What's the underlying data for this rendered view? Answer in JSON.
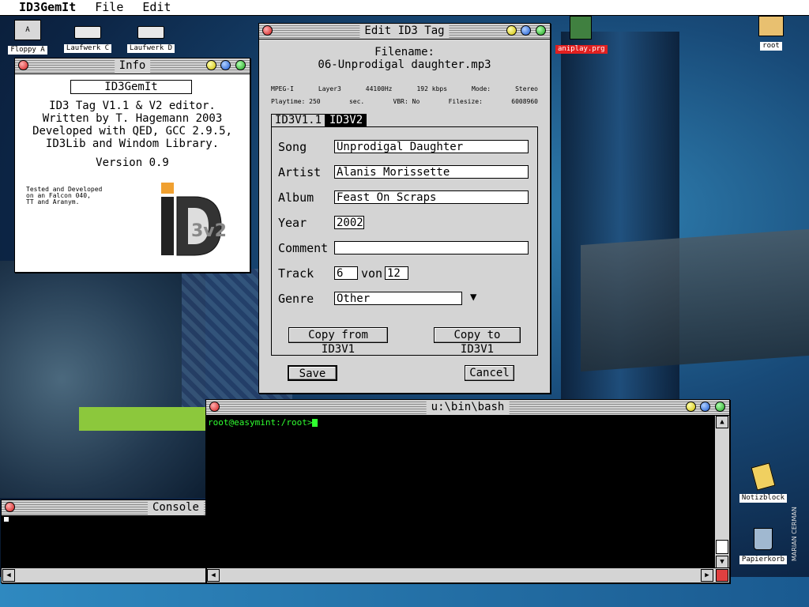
{
  "menubar": {
    "app": "ID3GemIt",
    "items": [
      "File",
      "Edit"
    ]
  },
  "desktop_icons": {
    "floppy": "Floppy A",
    "drive_c": "Laufwerk C",
    "drive_d": "Laufwerk D",
    "aniplay": "aniplay.prg",
    "root": "root",
    "notepad": "Notizblock",
    "trash": "Papierkorb"
  },
  "info_window": {
    "title": "Info",
    "app_name": "ID3GemIt",
    "lines": [
      "ID3 Tag V1.1 & V2 editor.",
      "Written by T. Hagemann 2003",
      "Developed with QED, GCC 2.9.5,",
      "ID3Lib and Windom Library."
    ],
    "version": "Version 0.9",
    "tested": [
      "Tested and Developed",
      "on an Falcon 040,",
      "TT and Aranym."
    ],
    "logo_text": "3v2"
  },
  "edit_window": {
    "title": "Edit ID3 Tag",
    "filename_label": "Filename:",
    "filename": "06-Unprodigal daughter.mp3",
    "info_row1": [
      "MPEG-I",
      "Layer3",
      "44100Hz",
      "192 kbps",
      "Mode:",
      "Stereo"
    ],
    "info_row2": [
      "Playtime: 250",
      "sec.",
      "VBR: No",
      "Filesize:",
      "6008960"
    ],
    "tabs": [
      "ID3V1.1",
      "ID3V2"
    ],
    "active_tab": "ID3V2",
    "labels": {
      "song": "Song",
      "artist": "Artist",
      "album": "Album",
      "year": "Year",
      "comment": "Comment",
      "track": "Track",
      "von": "von",
      "genre": "Genre"
    },
    "values": {
      "song": "Unprodigal Daughter",
      "artist": "Alanis Morissette",
      "album": "Feast On Scraps",
      "year": "2002",
      "comment": "",
      "track": "6__",
      "track_total": "12_",
      "genre": "Other"
    },
    "buttons": {
      "copy_from": "Copy from ID3V1",
      "copy_to": "Copy to ID3V1",
      "save": "Save",
      "cancel": "Cancel"
    }
  },
  "terminal": {
    "title": "u:\\bin\\bash",
    "prompt": "root@easymint:/root>"
  },
  "console": {
    "title": "Console"
  },
  "credit": "MARIAN CERMAN"
}
